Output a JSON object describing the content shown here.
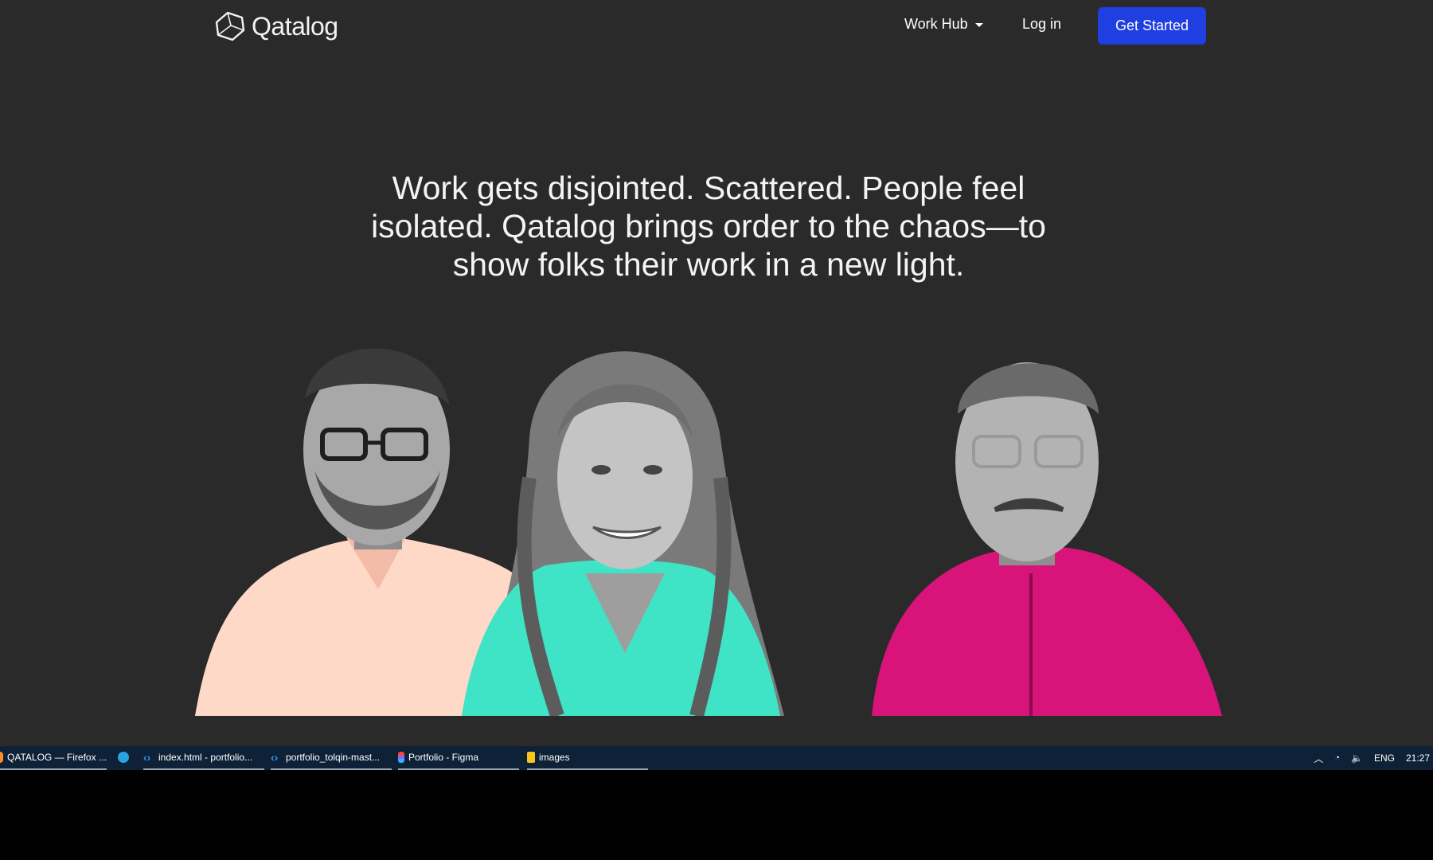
{
  "header": {
    "logo_text": "Qatalog",
    "nav": {
      "work_hub": "Work Hub",
      "login": "Log in"
    },
    "cta_label": "Get Started"
  },
  "hero": {
    "headline": "Work gets disjointed. Scattered. People feel isolated. Qatalog brings order to the chaos—to show folks their work in a new light."
  },
  "illustration": {
    "people": [
      {
        "shirt_color": "#ffd9c8"
      },
      {
        "shirt_color": "#3fe3c6"
      },
      {
        "shirt_color": "#d8137a"
      }
    ]
  },
  "taskbar": {
    "items": [
      {
        "icon": "firefox-icon",
        "label": "QATALOG — Firefox ..."
      },
      {
        "icon": "telegram-icon",
        "label": ""
      },
      {
        "icon": "vscode-icon",
        "label": "index.html - portfolio..."
      },
      {
        "icon": "vscode-icon",
        "label": "portfolio_tolqin-mast..."
      },
      {
        "icon": "figma-icon",
        "label": "Portfolio - Figma"
      },
      {
        "icon": "folder-icon",
        "label": "images"
      }
    ],
    "tray": {
      "language": "ENG",
      "time": "21:27"
    }
  }
}
